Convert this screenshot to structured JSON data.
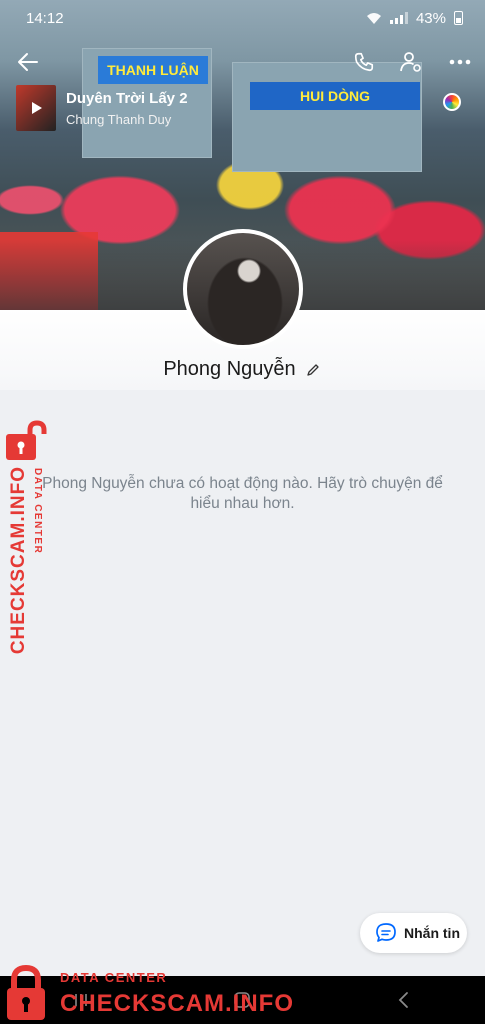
{
  "status_bar": {
    "time": "14:12",
    "battery": "43%"
  },
  "music": {
    "title": "Duyên Trời Lấy 2",
    "artist": "Chung Thanh Duy"
  },
  "cover": {
    "signs": [
      "THANH LUẬN",
      "HUI DÒNG"
    ]
  },
  "profile": {
    "name": "Phong Nguyễn",
    "empty_message": "Phong Nguyễn chưa có hoạt động nào. Hãy trò chuyện để hiểu nhau hơn."
  },
  "chat_button": {
    "label": "Nhắn tin"
  },
  "watermark": {
    "brand": "CHECKSCAM.INFO",
    "tagline": "DATA CENTER"
  },
  "icons": {
    "back": "back-arrow-icon",
    "call": "phone-icon",
    "user_settings": "user-settings-icon",
    "more": "more-dots-icon",
    "play": "play-icon",
    "edit": "pencil-icon",
    "chat": "chat-bubble-icon"
  },
  "colors": {
    "accent": "#0068ff",
    "watermark": "#e53935",
    "background": "#eef0f3"
  }
}
